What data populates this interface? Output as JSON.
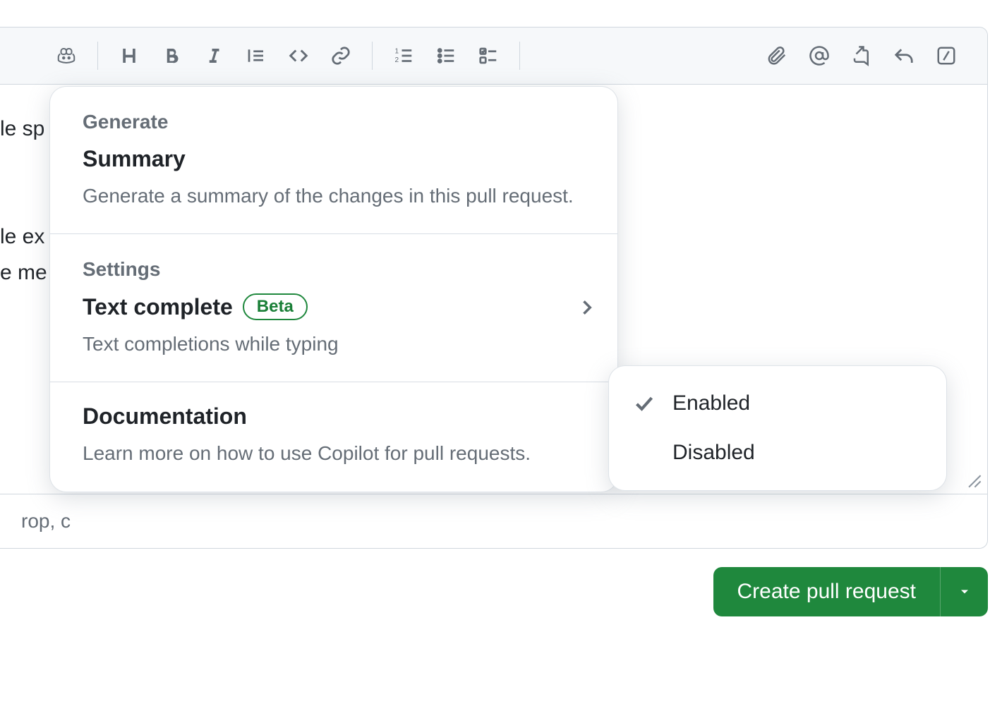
{
  "editor": {
    "visible_text_lines": [
      "le sp",
      "le ex",
      "e me"
    ],
    "footer_fragment": "rop, c"
  },
  "toolbar": {
    "groups": [
      [
        "copilot"
      ],
      [
        "heading",
        "bold",
        "italic",
        "quote",
        "code",
        "link"
      ],
      [
        "numbered-list",
        "bullet-list",
        "task-list"
      ],
      [
        "attach",
        "mention",
        "cross-reference",
        "reply",
        "saved-replies"
      ]
    ]
  },
  "copilot_menu": {
    "sections": [
      {
        "header": "Generate",
        "items": [
          {
            "title": "Summary",
            "desc": "Generate a summary of the changes in this pull request."
          }
        ]
      },
      {
        "header": "Settings",
        "items": [
          {
            "title": "Text complete",
            "badge": "Beta",
            "desc": "Text completions while typing",
            "has_submenu": true
          }
        ]
      },
      {
        "header": "",
        "items": [
          {
            "title": "Documentation",
            "desc": "Learn more on how to use Copilot for pull requests."
          }
        ]
      }
    ]
  },
  "submenu": {
    "options": [
      {
        "label": "Enabled",
        "checked": true
      },
      {
        "label": "Disabled",
        "checked": false
      }
    ]
  },
  "actions": {
    "primary_label": "Create pull request"
  },
  "colors": {
    "primary_green": "#1f883d",
    "border": "#d0d7de",
    "muted_text": "#656d76"
  }
}
